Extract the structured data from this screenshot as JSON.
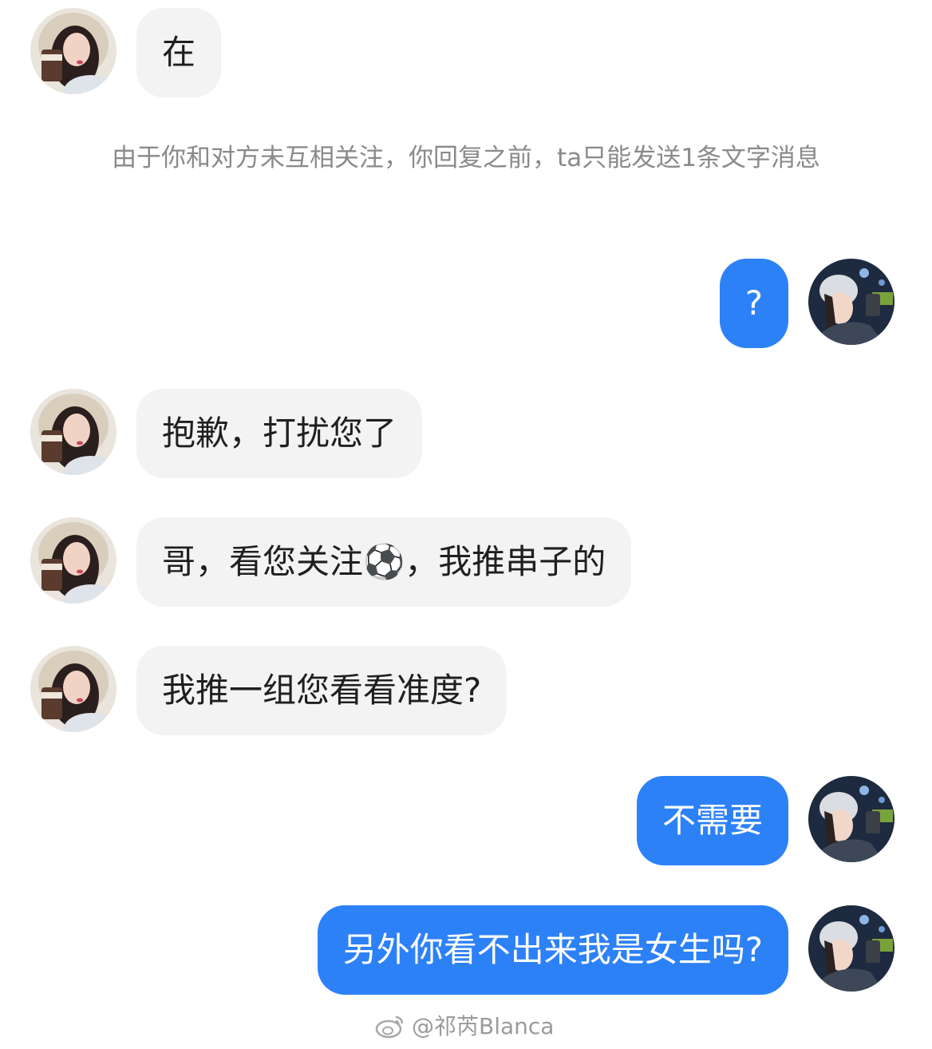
{
  "notice": {
    "text": "由于你和对方未互相关注，你回复之前，ta只能发送1条文字消息"
  },
  "messages": [
    {
      "side": "in",
      "text": "在"
    },
    {
      "side": "out",
      "text": "?"
    },
    {
      "side": "in",
      "text": "抱歉，打扰您了"
    },
    {
      "side": "in",
      "text": "哥，看您关注⚽，我推串子的"
    },
    {
      "side": "in",
      "text": "我推一组您看看准度?"
    },
    {
      "side": "out",
      "text": "不需要"
    },
    {
      "side": "out",
      "text": "另外你看不出来我是女生吗?"
    }
  ],
  "watermark": {
    "text": "@祁芮Blanca",
    "icon": "weibo-icon"
  },
  "colors": {
    "outgoing_bubble": "#2d81f7",
    "incoming_bubble": "#f3f3f3",
    "notice_text": "#8a8a8a"
  }
}
